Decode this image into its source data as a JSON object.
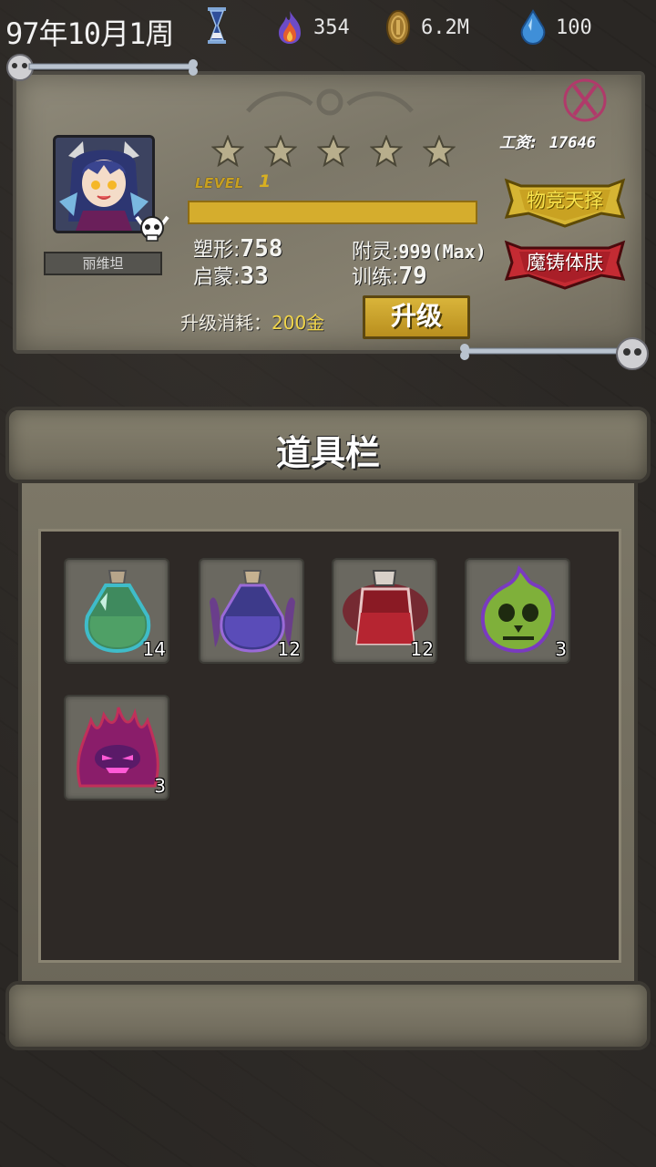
{
  "topbar": {
    "date": "97年10月1周",
    "resources": [
      {
        "icon": "flame-icon",
        "value": "354"
      },
      {
        "icon": "coin-icon",
        "value": "6.2M"
      },
      {
        "icon": "water-drop-icon",
        "value": "100"
      }
    ]
  },
  "character": {
    "name": "丽维坦",
    "stars": 5,
    "level_label": "LEVEL",
    "level": "1",
    "exp_fraction": 1.0,
    "salary_label": "工资:",
    "salary": "17646",
    "stats": {
      "shape_label": "塑形:",
      "shape": "758",
      "spirit_label": "附灵:",
      "spirit": "999(Max)",
      "enlighten_label": "启蒙:",
      "enlighten": "33",
      "train_label": "训练:",
      "train": "79"
    },
    "buttons": {
      "natural_selection": "物竞天择",
      "demon_forge": "魔铸体肤",
      "upgrade": "升级"
    },
    "upgrade_cost_label": "升级消耗：",
    "upgrade_cost": "200金"
  },
  "inventory": {
    "title": "道具栏",
    "items": [
      {
        "icon": "green-potion-icon",
        "count": "14"
      },
      {
        "icon": "purple-potion-icon",
        "count": "12"
      },
      {
        "icon": "red-potion-icon",
        "count": "12"
      },
      {
        "icon": "green-ghost-skull-icon",
        "count": "3"
      },
      {
        "icon": "purple-flame-demon-icon",
        "count": "3"
      }
    ]
  },
  "colors": {
    "accent_gold": "#d5ad2d",
    "button_red": "#b8262c",
    "panel_stone": "#86806f"
  }
}
